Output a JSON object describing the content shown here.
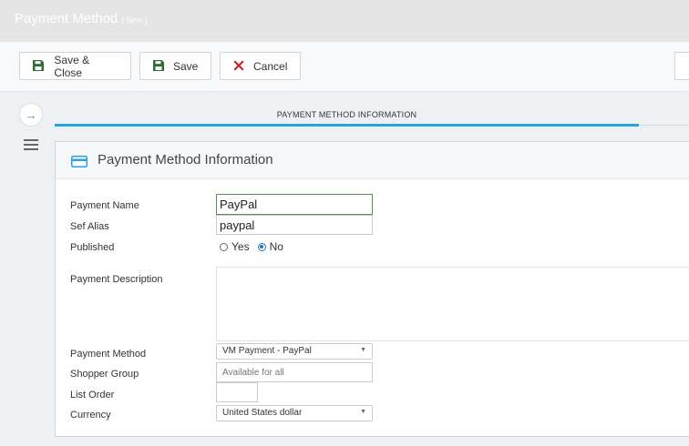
{
  "header": {
    "title": "Payment Method",
    "badge": "[ New ]"
  },
  "toolbar": {
    "save_close_label": "Save & Close",
    "save_label": "Save",
    "cancel_label": "Cancel"
  },
  "tab": {
    "label": "PAYMENT METHOD INFORMATION"
  },
  "panel": {
    "title": "Payment Method Information"
  },
  "form": {
    "payment_name": {
      "label": "Payment Name",
      "value": "PayPal"
    },
    "sef_alias": {
      "label": "Sef Alias",
      "value": "paypal"
    },
    "published": {
      "label": "Published",
      "options": [
        "Yes",
        "No"
      ],
      "selected": "No"
    },
    "payment_description": {
      "label": "Payment Description",
      "value": ""
    },
    "payment_method": {
      "label": "Payment Method",
      "value": "VM Payment - PayPal"
    },
    "shopper_group": {
      "label": "Shopper Group",
      "placeholder": "Available for all"
    },
    "list_order": {
      "label": "List Order",
      "value": ""
    },
    "currency": {
      "label": "Currency",
      "value": "United States dollar"
    }
  },
  "colors": {
    "accent": "#2aa2de",
    "save_icon": "#2e6b35",
    "cancel_icon": "#c62828",
    "focus_border": "#5b8f4e"
  },
  "icons": {
    "save_close": "floppy-disk-icon",
    "save": "floppy-disk-icon",
    "cancel": "x-icon",
    "panel": "credit-card-icon",
    "sidebar_toggle": "arrow-right-icon",
    "sidebar_menu": "hamburger-menu-icon"
  }
}
